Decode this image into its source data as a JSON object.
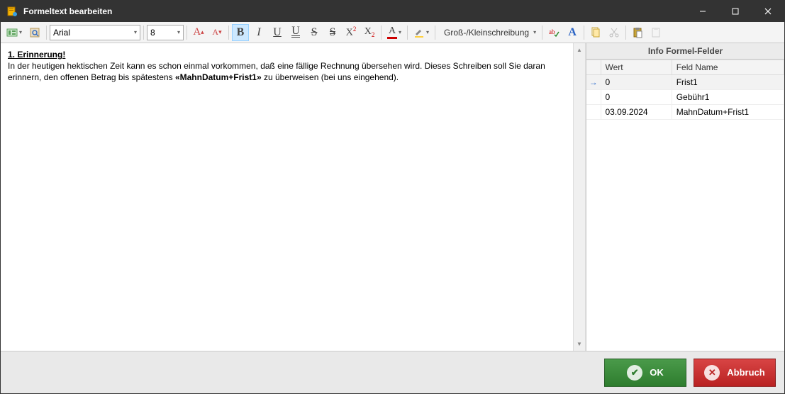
{
  "window": {
    "title": "Formeltext bearbeiten"
  },
  "toolbar": {
    "font_name": "Arial",
    "font_size": "8",
    "case_label": "Groß-/Kleinschreibung"
  },
  "editor": {
    "heading": "1. Erinnerung!",
    "body_pre": "In der heutigen hektischen Zeit kann es schon einmal vorkommen, daß eine fällige Rechnung übersehen wird. Dieses Schreiben soll Sie daran erinnern, den offenen Betrag bis spätestens ",
    "field": "«MahnDatum+Frist1»",
    "body_post": " zu überweisen (bei uns eingehend)."
  },
  "info_panel": {
    "title": "Info Formel-Felder",
    "columns": {
      "value": "Wert",
      "name": "Feld Name"
    },
    "rows": [
      {
        "value": "0",
        "name": "Frist1",
        "selected": true
      },
      {
        "value": "0",
        "name": "Gebühr1",
        "selected": false
      },
      {
        "value": "03.09.2024",
        "name": "MahnDatum+Frist1",
        "selected": false
      }
    ]
  },
  "footer": {
    "ok": "OK",
    "cancel": "Abbruch"
  }
}
